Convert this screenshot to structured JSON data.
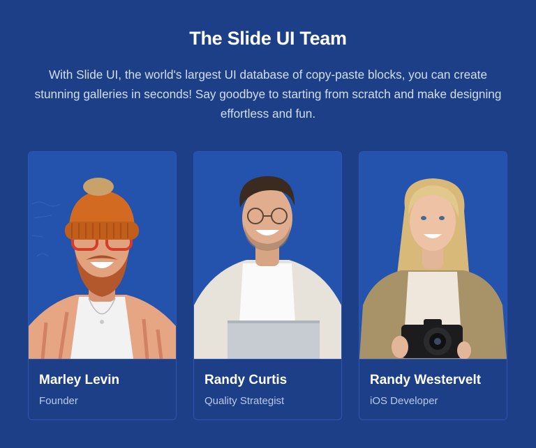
{
  "header": {
    "title": "The Slide UI Team",
    "description": "With Slide UI, the world's largest UI database of copy-paste blocks, you can create stunning galleries in seconds! Say goodbye to starting from scratch and make designing effortless and fun."
  },
  "team": [
    {
      "name": "Marley Levin",
      "role": "Founder"
    },
    {
      "name": "Randy Curtis",
      "role": "Quality Strategist"
    },
    {
      "name": "Randy Westervelt",
      "role": "iOS Developer"
    }
  ],
  "colors": {
    "background": "#1c3f88",
    "card_photo_bg": "#2453ad",
    "card_border": "#2f57b2",
    "text_primary": "#ffffff",
    "text_secondary": "#b9c9ea"
  }
}
